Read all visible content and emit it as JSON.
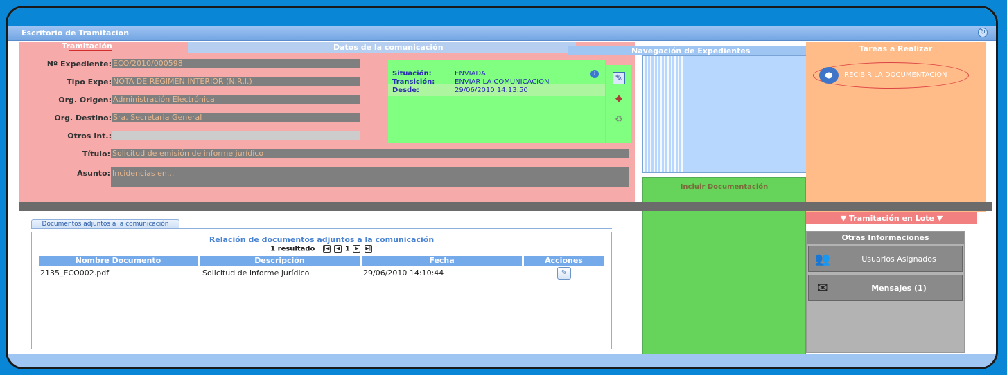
{
  "window": {
    "title": "Escritorio de Tramitacion"
  },
  "tramitacion": {
    "tab_label": "Tramitación",
    "datos_label": "Datos de la comunicación",
    "fields": {
      "expediente": {
        "label": "Nº Expediente:",
        "value": "ECO/2010/000598"
      },
      "tipo_expe": {
        "label": "Tipo Expe:",
        "value": "NOTA DE REGIMEN INTERIOR (N.R.I.)"
      },
      "org_origen": {
        "label": "Org. Origen:",
        "value": "Administración Electrónica"
      },
      "org_destino": {
        "label": "Org. Destino:",
        "value": "Sra. Secretaria General"
      },
      "otros_int": {
        "label": "Otros Int.:",
        "value": ""
      },
      "titulo": {
        "label": "Título:",
        "value": "Solicitud de emisión de informe jurídico"
      },
      "asunto": {
        "label": "Asunto:",
        "value": "Incidencias en..."
      }
    }
  },
  "comunicacion": {
    "situacion": {
      "label": "Situación:",
      "value": "ENVIADA"
    },
    "transicion": {
      "label": "Transición:",
      "value": "ENVIAR LA COMUNICACION"
    },
    "desde": {
      "label": "Desde:",
      "value": "29/06/2010 14:13:50"
    }
  },
  "navegacion": {
    "title": "Navegación de Expedientes"
  },
  "incluir": {
    "title": "Incluir Documentación"
  },
  "tareas": {
    "title": "Tareas a Realizar",
    "items": [
      {
        "label": "RECIBIR LA DOCUMENTACION"
      }
    ],
    "lote": "▼ Tramitación en Lote ▼"
  },
  "otras": {
    "title": "Otras Informaciones",
    "items": [
      {
        "label": "Usuarios Asignados",
        "icon": "users-icon"
      },
      {
        "label": "Mensajes (1)",
        "icon": "mailbox-icon"
      }
    ]
  },
  "documentos": {
    "tab_label": "Documentos adjuntos a la comunicación",
    "title": "Relación de documentos adjuntos a la comunicación",
    "result_text": "1 resultado",
    "page": "1",
    "columns": [
      "Nombre Documento",
      "Descripción",
      "Fecha",
      "Acciones"
    ],
    "rows": [
      {
        "nombre": "2135_ECO002.pdf",
        "descripcion": "Solicitud de informe jurídico",
        "fecha": "29/06/2010 14:10:44"
      }
    ]
  }
}
